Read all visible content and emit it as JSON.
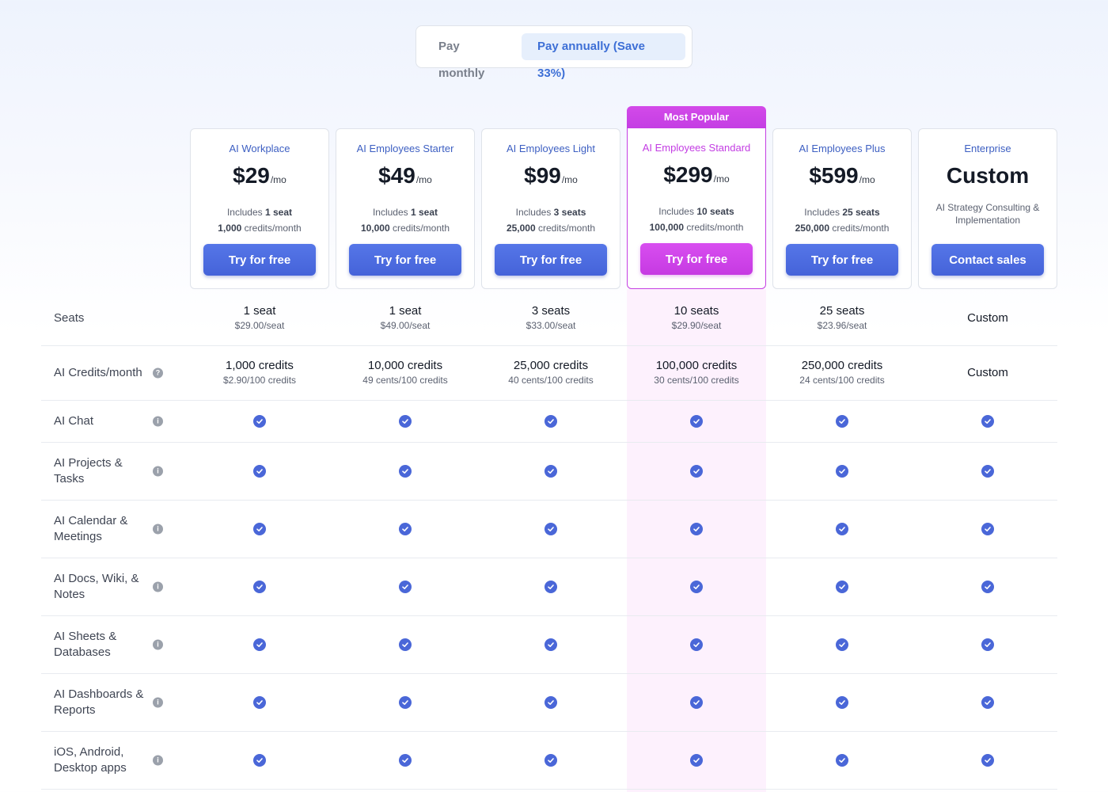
{
  "billing_toggle": {
    "monthly_label": "Pay monthly",
    "annually_label": "Pay annually (Save 33%)",
    "selected": "annually"
  },
  "popular_badge": "Most Popular",
  "colors": {
    "accent_blue": "#4a67d8",
    "accent_pink": "#c63ae2",
    "popular_column_bg": "#fdf1fd"
  },
  "plans": [
    {
      "name": "AI Workplace",
      "price": "$29",
      "period": "/mo",
      "includes_prefix": "Includes",
      "seats": "1 seat",
      "credits": "1,000",
      "credits_suffix": "credits/month",
      "cta": "Try for free"
    },
    {
      "name": "AI Employees Starter",
      "price": "$49",
      "period": "/mo",
      "includes_prefix": "Includes",
      "seats": "1 seat",
      "credits": "10,000",
      "credits_suffix": "credits/month",
      "cta": "Try for free"
    },
    {
      "name": "AI Employees Light",
      "price": "$99",
      "period": "/mo",
      "includes_prefix": "Includes",
      "seats": "3 seats",
      "credits": "25,000",
      "credits_suffix": "credits/month",
      "cta": "Try for free"
    },
    {
      "name": "AI Employees Standard",
      "price": "$299",
      "period": "/mo",
      "includes_prefix": "Includes",
      "seats": "10 seats",
      "credits": "100,000",
      "credits_suffix": "credits/month",
      "cta": "Try for free"
    },
    {
      "name": "AI Employees Plus",
      "price": "$599",
      "period": "/mo",
      "includes_prefix": "Includes",
      "seats": "25 seats",
      "credits": "250,000",
      "credits_suffix": "credits/month",
      "cta": "Try for free"
    },
    {
      "name": "Enterprise",
      "price": "Custom",
      "description": "AI Strategy Consulting & Implementation",
      "cta": "Contact sales"
    }
  ],
  "seats_row": {
    "label": "Seats",
    "cells": [
      {
        "main": "1 seat",
        "sub": "$29.00/seat"
      },
      {
        "main": "1 seat",
        "sub": "$49.00/seat"
      },
      {
        "main": "3 seats",
        "sub": "$33.00/seat"
      },
      {
        "main": "10 seats",
        "sub": "$29.90/seat"
      },
      {
        "main": "25 seats",
        "sub": "$23.96/seat"
      },
      {
        "main": "Custom",
        "sub": ""
      }
    ]
  },
  "credits_row": {
    "label": "AI Credits/month",
    "icon": "question-icon",
    "icon_glyph": "?",
    "cells": [
      {
        "main": "1,000 credits",
        "sub": "$2.90/100 credits"
      },
      {
        "main": "10,000 credits",
        "sub": "49 cents/100 credits"
      },
      {
        "main": "25,000 credits",
        "sub": "40 cents/100 credits"
      },
      {
        "main": "100,000 credits",
        "sub": "30 cents/100 credits"
      },
      {
        "main": "250,000 credits",
        "sub": "24 cents/100 credits"
      },
      {
        "main": "Custom",
        "sub": ""
      }
    ]
  },
  "info_icon_glyph": "i",
  "features": [
    {
      "label": "AI Chat",
      "included": [
        true,
        true,
        true,
        true,
        true,
        true
      ]
    },
    {
      "label": "AI Projects & Tasks",
      "included": [
        true,
        true,
        true,
        true,
        true,
        true
      ]
    },
    {
      "label": "AI Calendar & Meetings",
      "included": [
        true,
        true,
        true,
        true,
        true,
        true
      ]
    },
    {
      "label": "AI Docs, Wiki, & Notes",
      "included": [
        true,
        true,
        true,
        true,
        true,
        true
      ]
    },
    {
      "label": "AI Sheets & Databases",
      "included": [
        true,
        true,
        true,
        true,
        true,
        true
      ]
    },
    {
      "label": "AI Dashboards & Reports",
      "included": [
        true,
        true,
        true,
        true,
        true,
        true
      ]
    },
    {
      "label": "iOS, Android, Desktop apps",
      "included": [
        true,
        true,
        true,
        true,
        true,
        true
      ]
    }
  ]
}
